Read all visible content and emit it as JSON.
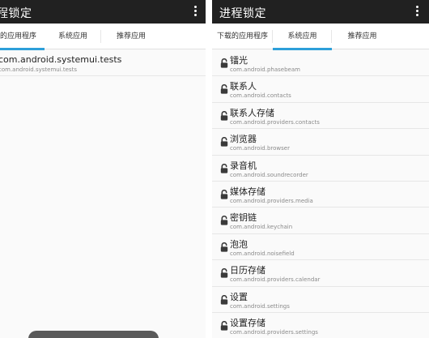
{
  "left": {
    "title": "程锁定",
    "tabs": [
      {
        "label": "的应用程序",
        "active": true
      },
      {
        "label": "系统应用",
        "active": false
      },
      {
        "label": "推荐应用",
        "active": false
      }
    ],
    "items": [
      {
        "name": "com.android.systemui.tests",
        "package": "com.android.systemui.tests"
      }
    ]
  },
  "right": {
    "title": "进程锁定",
    "tabs": [
      {
        "label": "下载的应用程序",
        "active": false
      },
      {
        "label": "系统应用",
        "active": true
      },
      {
        "label": "推荐应用",
        "active": false
      }
    ],
    "items": [
      {
        "name": "镭光",
        "package": "com.android.phasebeam"
      },
      {
        "name": "联系人",
        "package": "com.android.contacts"
      },
      {
        "name": "联系人存储",
        "package": "com.android.providers.contacts"
      },
      {
        "name": "浏览器",
        "package": "com.android.browser"
      },
      {
        "name": "录音机",
        "package": "com.android.soundrecorder"
      },
      {
        "name": "媒体存储",
        "package": "com.android.providers.media"
      },
      {
        "name": "密钥链",
        "package": "com.android.keychain"
      },
      {
        "name": "泡泡",
        "package": "com.android.noisefield"
      },
      {
        "name": "日历存储",
        "package": "com.android.providers.calendar"
      },
      {
        "name": "设置",
        "package": "com.android.settings"
      },
      {
        "name": "设置存储",
        "package": "com.android.providers.settings"
      }
    ]
  },
  "icons": {
    "lock": "unlocked-padlock-icon",
    "menu": "overflow-menu-icon"
  },
  "colors": {
    "appbar": "#212121",
    "accent": "#2d9fd9",
    "background": "#fafafa"
  }
}
